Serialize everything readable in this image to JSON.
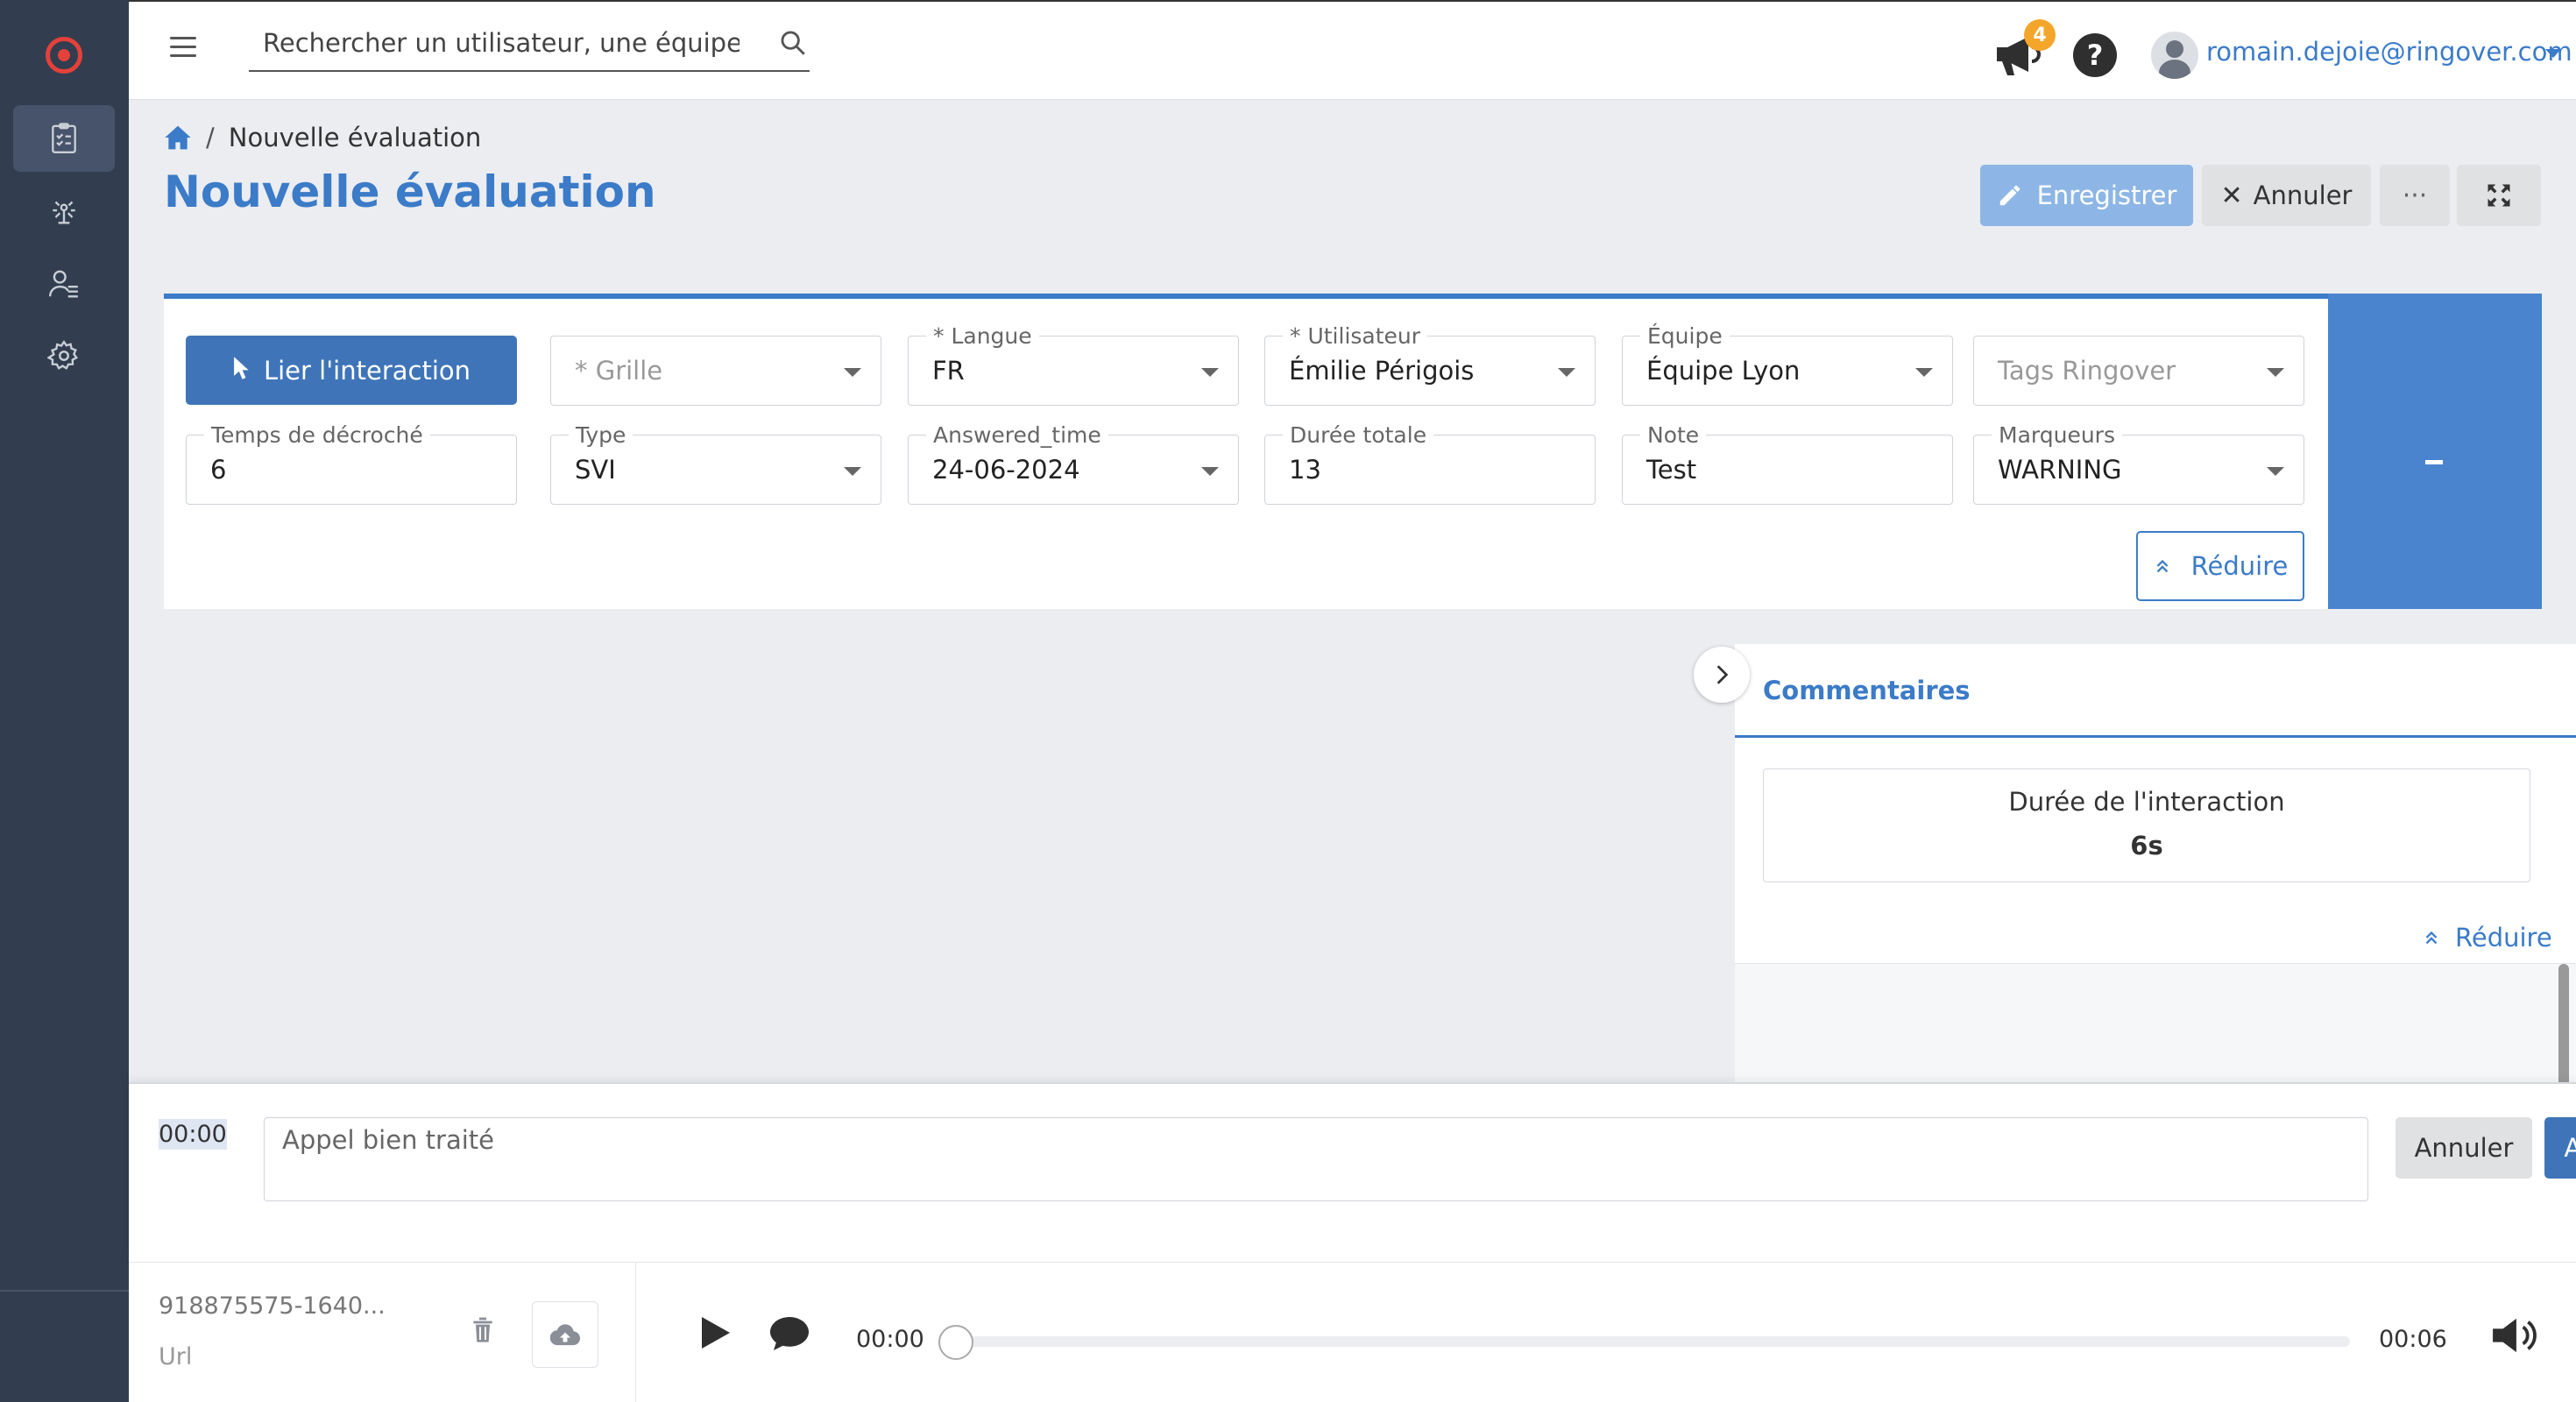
{
  "app": {
    "accent_color": "#3b7bc8",
    "sidebar_color": "#323e4f"
  },
  "sidebar": {
    "items": [
      {
        "icon": "clipboard-checklist-icon",
        "active": true
      },
      {
        "icon": "antenna-icon",
        "active": false
      },
      {
        "icon": "user-list-icon",
        "active": false
      },
      {
        "icon": "gear-icon",
        "active": false
      }
    ]
  },
  "topbar": {
    "search_placeholder": "Rechercher un utilisateur, une équipe",
    "notification_count": "4",
    "help_label": "?",
    "user_email": "romain.dejoie@ringover.com"
  },
  "breadcrumb": {
    "separator": "/",
    "current": "Nouvelle évaluation"
  },
  "page": {
    "title": "Nouvelle évaluation"
  },
  "actions": {
    "save_label": "Enregistrer",
    "cancel_label": "Annuler",
    "more_label": "···"
  },
  "form": {
    "link_button_label": "Lier l'interaction",
    "grille": {
      "placeholder": "* Grille"
    },
    "langue": {
      "label": "* Langue",
      "value": "FR"
    },
    "utilisateur": {
      "label": "* Utilisateur",
      "value": "Émilie Périgois"
    },
    "equipe": {
      "label": "Équipe",
      "value": "Équipe Lyon"
    },
    "tags": {
      "placeholder": "Tags Ringover"
    },
    "temps_decroche": {
      "label": "Temps de décroché",
      "value": "6"
    },
    "type": {
      "label": "Type",
      "value": "SVI"
    },
    "answered_time": {
      "label": "Answered_time",
      "value": "24-06-2024"
    },
    "duree_totale": {
      "label": "Durée totale",
      "value": "13"
    },
    "note": {
      "label": "Note",
      "value": "Test"
    },
    "marqueurs": {
      "label": "Marqueurs",
      "value": "WARNING"
    },
    "reduce_label": "Réduire"
  },
  "comments": {
    "tab_label": "Commentaires",
    "duration_title": "Durée de l'interaction",
    "duration_value": "6s",
    "reduce_label": "Réduire"
  },
  "comment_entry": {
    "timestamp": "00:00",
    "placeholder": "Appel bien traité",
    "cancel_label": "Annuler",
    "add_label": "Ajouter"
  },
  "player": {
    "file_name": "918875575-1640...",
    "url_label": "Url",
    "current_time": "00:00",
    "total_time": "00:06",
    "progress": 0
  }
}
